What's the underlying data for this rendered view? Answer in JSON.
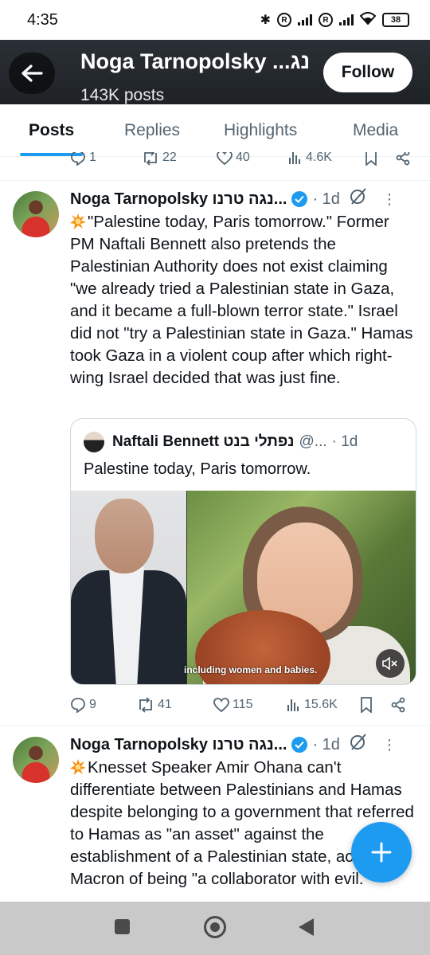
{
  "status_bar": {
    "time": "4:35",
    "battery": "38"
  },
  "profile": {
    "name": "Noga Tarnopolsky ...נג",
    "posts_count": "143K posts",
    "follow_label": "Follow"
  },
  "tabs": [
    {
      "label": "Posts",
      "active": true
    },
    {
      "label": "Replies",
      "active": false
    },
    {
      "label": "Highlights",
      "active": false
    },
    {
      "label": "Media",
      "active": false
    }
  ],
  "prev_tweet_actions": {
    "replies": "1",
    "reposts": "22",
    "likes": "40",
    "views": "4.6K"
  },
  "tweets": [
    {
      "author": "Noga Tarnopolsky נגה טרנו...",
      "time": "1d",
      "text": "\"Palestine today, Paris tomorrow.\" Former PM Naftali Bennett also pretends the Palestinian Authority does not exist claiming \"we already tried a Palestinian state in Gaza, and it became a full-blown terror state.\" Israel did not \"try a Palestinian state in Gaza.\" Hamas took Gaza in a violent coup after which right-wing Israel decided that was just fine.",
      "quote": {
        "author": "Naftali Bennett נפתלי בנט",
        "handle": "@...",
        "time": "1d",
        "text": "Palestine today, Paris tomorrow.",
        "video_caption": "including women and babies."
      },
      "actions": {
        "replies": "9",
        "reposts": "41",
        "likes": "115",
        "views": "15.6K"
      }
    },
    {
      "author": "Noga Tarnopolsky נגה טרנו...",
      "time": "1d",
      "text": "Knesset Speaker Amir Ohana can't differentiate between Palestinians and Hamas despite belonging to a government that referred to Hamas as \"an asset\" against the establishment of a Palestinian state, accuses Macron of being \"a collaborator with evil.\""
    }
  ],
  "colors": {
    "accent": "#1d9bf0",
    "text": "#0f1419",
    "muted": "#536471",
    "border": "#cfd9de"
  },
  "icons": [
    "back-arrow-icon",
    "verified-badge-icon",
    "grok-icon",
    "more-icon",
    "reply-icon",
    "repost-icon",
    "like-icon",
    "views-icon",
    "bookmark-icon",
    "share-icon",
    "mute-icon",
    "compose-plus-icon"
  ]
}
